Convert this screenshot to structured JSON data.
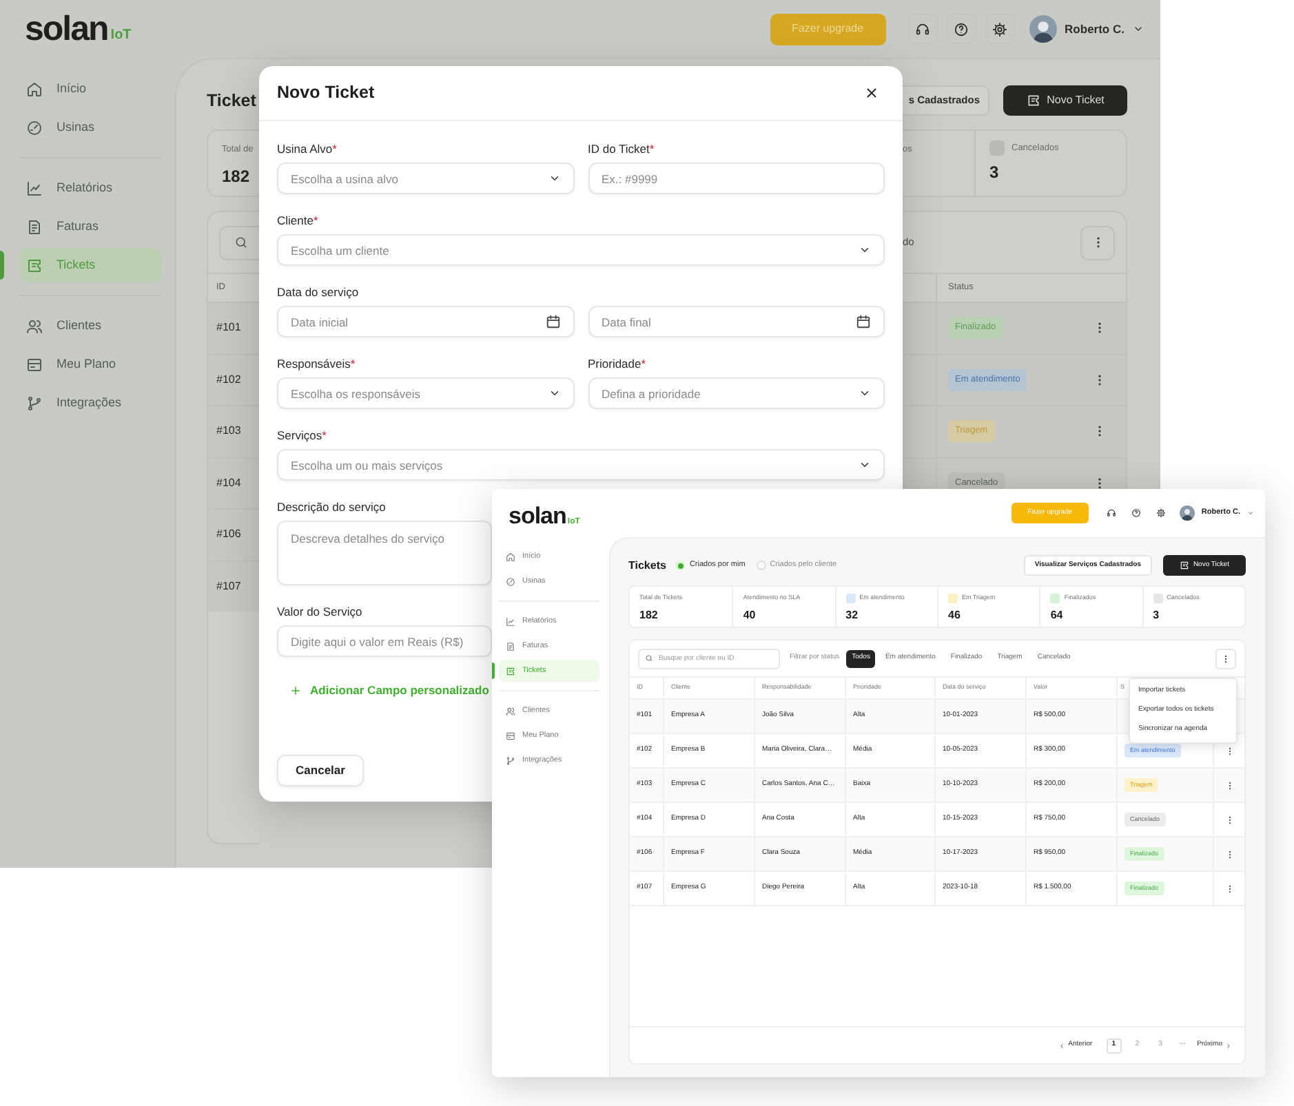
{
  "background_app": {
    "logo": {
      "name": "solan",
      "suffix": "IoT"
    },
    "sidebar": {
      "groups": [
        [
          {
            "label": "Início",
            "selected": false
          },
          {
            "label": "Usinas",
            "selected": false
          }
        ],
        [
          {
            "label": "Relatórios",
            "selected": false
          },
          {
            "label": "Faturas",
            "selected": false
          },
          {
            "label": "Tickets",
            "selected": true
          }
        ],
        [
          {
            "label": "Clientes",
            "selected": false
          },
          {
            "label": "Meu Plano",
            "selected": false
          },
          {
            "label": "Integrações",
            "selected": false
          }
        ]
      ]
    },
    "header": {
      "upgrade_button": "Fazer upgrade",
      "user_name": "Roberto C."
    },
    "title": "Ticket",
    "left_stat": {
      "label": "Total de",
      "value": "182"
    },
    "actions": [
      {
        "label": "s Cadastrados",
        "kind": "outline"
      },
      {
        "label": "Novo Ticket",
        "kind": "primary"
      }
    ],
    "right_stats": [
      {
        "label": "os"
      },
      {
        "label": "Cancelados",
        "value": "3",
        "color": "#b8bbb5"
      }
    ],
    "filter_text": "do",
    "table": {
      "columns": [
        "ID",
        "Status"
      ],
      "rows": [
        {
          "id": "#101",
          "status": {
            "label": "Finalizado",
            "kind": "done"
          }
        },
        {
          "id": "#102",
          "status": {
            "label": "Em atendimento",
            "kind": "in_progress"
          }
        },
        {
          "id": "#103",
          "status": {
            "label": "Triagem",
            "kind": "triage"
          }
        },
        {
          "id": "#104",
          "status": {
            "label": "Cancelado",
            "kind": "canceled"
          }
        },
        {
          "id": "#106"
        },
        {
          "id": "#107"
        }
      ]
    }
  },
  "modal": {
    "title": "Novo Ticket",
    "rows": [
      {
        "fields": [
          {
            "label": "Usina Alvo",
            "required_mark": "*",
            "placeholder": "Escolha a usina alvo",
            "kind": "select"
          },
          {
            "label": "ID do Ticket",
            "required_mark": "*",
            "placeholder": "Ex.: #9999",
            "kind": "text"
          }
        ]
      },
      {
        "fields": [
          {
            "label": "Cliente",
            "required_mark": "*",
            "placeholder": "Escolha um cliente",
            "kind": "select"
          }
        ]
      },
      {
        "label": "Data do serviço",
        "fields": [
          {
            "placeholder": "Data inicial",
            "kind": "date"
          },
          {
            "placeholder": "Data final",
            "kind": "date"
          }
        ]
      },
      {
        "fields": [
          {
            "label": "Responsáveis",
            "required_mark": "*",
            "placeholder": "Escolha os responsáveis",
            "kind": "select"
          },
          {
            "label": "Prioridade",
            "required_mark": "*",
            "placeholder": "Defina a prioridade",
            "kind": "select"
          }
        ]
      },
      {
        "fields": [
          {
            "label": "Serviços",
            "required_mark": "*",
            "placeholder": "Escolha um ou mais serviços",
            "kind": "select"
          }
        ]
      },
      {
        "fields": [
          {
            "label": "Descrição do serviço",
            "placeholder": "Descreva detalhes do serviço",
            "kind": "textarea"
          }
        ]
      },
      {
        "fields": [
          {
            "label": "Valor do Serviço",
            "placeholder": "Digite aqui o valor em Reais (R$)",
            "kind": "text"
          }
        ]
      }
    ],
    "add_field_link": "Adicionar Campo personalizado",
    "cancel_button": "Cancelar"
  },
  "foreground_app": {
    "logo": {
      "name": "solan",
      "suffix": "IoT"
    },
    "sidebar": {
      "groups": [
        [
          {
            "label": "Início",
            "selected": false
          },
          {
            "label": "Usinas",
            "selected": false
          }
        ],
        [
          {
            "label": "Relatórios",
            "selected": false
          },
          {
            "label": "Faturas",
            "selected": false
          },
          {
            "label": "Tickets",
            "selected": true
          }
        ],
        [
          {
            "label": "Clientes",
            "selected": false
          },
          {
            "label": "Meu Plano",
            "selected": false
          },
          {
            "label": "Integrações",
            "selected": false
          }
        ]
      ]
    },
    "header": {
      "upgrade_button": "Fazer upgrade",
      "user_name": "Roberto C."
    },
    "title": "Tickets",
    "scopes": [
      {
        "label": "Criados por mim",
        "selected": true
      },
      {
        "label": "Criados pelo cliente",
        "selected": false
      }
    ],
    "actions": [
      {
        "label": "Visualizar Serviços Cadastrados",
        "kind": "outline"
      },
      {
        "label": "Novo Ticket",
        "kind": "primary"
      }
    ],
    "stats": [
      {
        "label": "Total de Tickets",
        "value": "182"
      },
      {
        "label": "Atendimento no SLA",
        "value": "40"
      },
      {
        "label": "Em atendimento",
        "value": "32",
        "color": "#dbe8fb"
      },
      {
        "label": "Em Triagem",
        "value": "46",
        "color": "#fcefc4"
      },
      {
        "label": "Finalizados",
        "value": "64",
        "color": "#d5f3d5"
      },
      {
        "label": "Cancelados",
        "value": "3",
        "color": "#e6e6e6"
      }
    ],
    "search": {
      "placeholder": "Busque por cliente ou ID"
    },
    "filter_label": "Filtrar por status",
    "filters": [
      {
        "label": "Todos",
        "selected": true
      },
      {
        "label": "Em atendimento",
        "selected": false
      },
      {
        "label": "Finalizado",
        "selected": false
      },
      {
        "label": "Triagem",
        "selected": false
      },
      {
        "label": "Cancelado",
        "selected": false
      }
    ],
    "table": {
      "columns": [
        "ID",
        "Cliente",
        "Responsabilidade",
        "Prioridade",
        "Data do serviço",
        "Valor",
        "S"
      ],
      "rows": [
        {
          "cells": [
            "#101",
            "Empresa A",
            "João Silva",
            "Alta",
            "10-01-2023",
            "R$ 500,00"
          ]
        },
        {
          "cells": [
            "#102",
            "Empresa B",
            "Maria Oliveira, Clara…",
            "Média",
            "10-05-2023",
            "R$ 300,00"
          ],
          "status": {
            "label": "Em atendimento",
            "kind": "in_progress"
          }
        },
        {
          "cells": [
            "#103",
            "Empresa C",
            "Carlos Santos, Ana C…",
            "Baixa",
            "10-10-2023",
            "R$ 200,00"
          ],
          "status": {
            "label": "Triagem",
            "kind": "triage"
          }
        },
        {
          "cells": [
            "#104",
            "Empresa D",
            "Ana Costa",
            "Alta",
            "10-15-2023",
            "R$ 750,00"
          ],
          "status": {
            "label": "Cancelado",
            "kind": "canceled"
          }
        },
        {
          "cells": [
            "#106",
            "Empresa F",
            "Clara Souza",
            "Média",
            "10-17-2023",
            "R$ 950,00"
          ],
          "status": {
            "label": "Finalizado",
            "kind": "done"
          }
        },
        {
          "cells": [
            "#107",
            "Empresa G",
            "Diego Pereira",
            "Alta",
            "2023-10-18",
            "R$ 1.500,00"
          ],
          "status": {
            "label": "Finalizado",
            "kind": "done"
          }
        }
      ]
    },
    "menu": [
      "Importar tickets",
      "Exportar todos os tickets",
      "Sincronizar na agenda"
    ],
    "pagination": {
      "previous": "Anterior",
      "pages": [
        {
          "label": "1",
          "selected": true
        },
        {
          "label": "2",
          "selected": false
        },
        {
          "label": "3",
          "selected": false
        }
      ],
      "ellipsis": "···",
      "next": "Próximo"
    }
  }
}
